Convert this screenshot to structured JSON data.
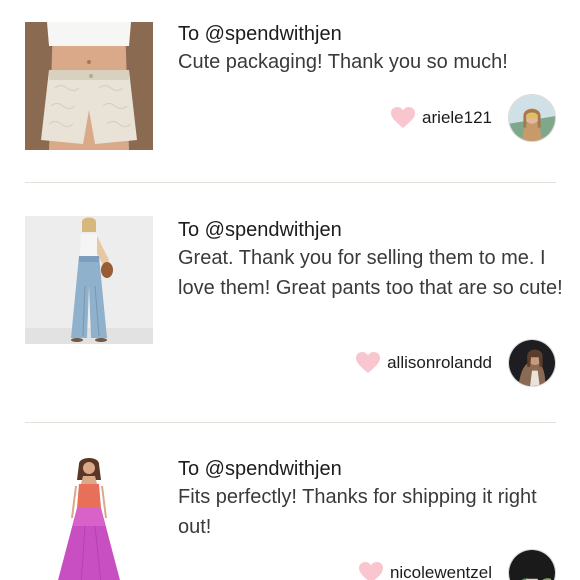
{
  "reviews": [
    {
      "to": "To @spendwithjen",
      "message": "Cute packaging! Thank you so much!",
      "username": "ariele121",
      "product_icon": "white-lace-shorts-photo",
      "avatar_icon": "user-avatar-photo"
    },
    {
      "to": "To @spendwithjen",
      "message": "Great. Thank you for selling them to me. I love them! Great pants too that are so cute!",
      "username": "allisonrolandd",
      "product_icon": "wide-leg-denim-pants-photo",
      "avatar_icon": "user-avatar-photo"
    },
    {
      "to": "To @spendwithjen",
      "message": "Fits perfectly! Thanks for shipping it right out!",
      "username": "nicolewentzel",
      "product_icon": "pink-maxi-dress-photo",
      "avatar_icon": "user-avatar-photo"
    }
  ],
  "colors": {
    "heart": "#f9c6cf",
    "divider": "#e3e0da",
    "text": "#3a3a3a"
  }
}
